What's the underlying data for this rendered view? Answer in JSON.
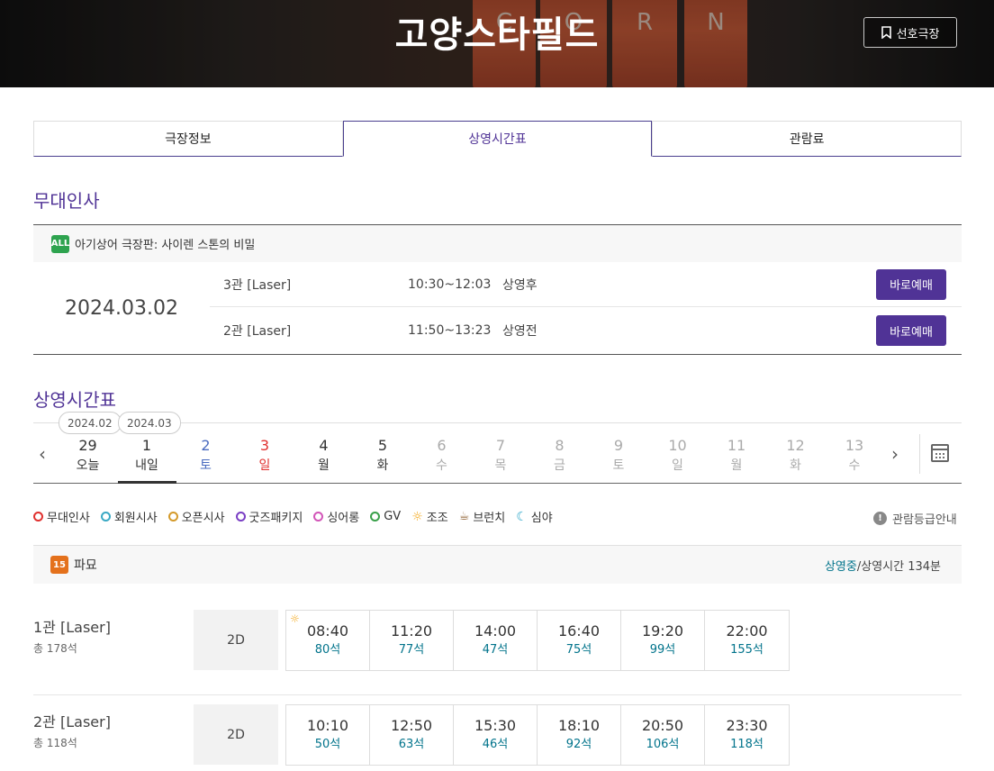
{
  "theater": {
    "name": "고양스타필드",
    "favorite_label": "선호극장"
  },
  "tabs": [
    {
      "label": "극장정보",
      "active": false
    },
    {
      "label": "상영시간표",
      "active": true
    },
    {
      "label": "관람료",
      "active": false
    }
  ],
  "stage_greeting": {
    "title": "무대인사",
    "movie": {
      "rating": "ALL",
      "title": "아기상어 극장판: 사이렌 스톤의 비밀"
    },
    "date": "2024.03.02",
    "rows": [
      {
        "hall": "3관 [Laser]",
        "time": "10:30~12:03",
        "status": "상영후",
        "button": "바로예매"
      },
      {
        "hall": "2관 [Laser]",
        "time": "11:50~13:23",
        "status": "상영전",
        "button": "바로예매"
      }
    ]
  },
  "schedule": {
    "title": "상영시간표",
    "months": [
      "2024.02",
      "2024.03"
    ],
    "days": [
      {
        "num": "29",
        "dow": "오늘",
        "color": "#333333",
        "selected": false
      },
      {
        "num": "1",
        "dow": "내일",
        "color": "#333333",
        "selected": true
      },
      {
        "num": "2",
        "dow": "토",
        "color": "#4a6bbf",
        "selected": false
      },
      {
        "num": "3",
        "dow": "일",
        "color": "#e0302e",
        "selected": false
      },
      {
        "num": "4",
        "dow": "월",
        "color": "#333333",
        "selected": false
      },
      {
        "num": "5",
        "dow": "화",
        "color": "#333333",
        "selected": false
      },
      {
        "num": "6",
        "dow": "수",
        "color": "#aaaaaa",
        "selected": false
      },
      {
        "num": "7",
        "dow": "목",
        "color": "#aaaaaa",
        "selected": false
      },
      {
        "num": "8",
        "dow": "금",
        "color": "#aaaaaa",
        "selected": false
      },
      {
        "num": "9",
        "dow": "토",
        "color": "#aaaaaa",
        "selected": false
      },
      {
        "num": "10",
        "dow": "일",
        "color": "#aaaaaa",
        "selected": false
      },
      {
        "num": "11",
        "dow": "월",
        "color": "#aaaaaa",
        "selected": false
      },
      {
        "num": "12",
        "dow": "화",
        "color": "#aaaaaa",
        "selected": false
      },
      {
        "num": "13",
        "dow": "수",
        "color": "#aaaaaa",
        "selected": false
      }
    ],
    "legend": [
      {
        "label": "무대인사",
        "icon": "stage-greeting-icon",
        "color": "#e0302e"
      },
      {
        "label": "회원시사",
        "icon": "member-preview-icon",
        "color": "#3aa9c4"
      },
      {
        "label": "오픈시사",
        "icon": "open-preview-icon",
        "color": "#d49a2a"
      },
      {
        "label": "굿즈패키지",
        "icon": "goods-package-icon",
        "color": "#7a3fc4"
      },
      {
        "label": "싱어롱",
        "icon": "sing-along-icon",
        "color": "#d255b8"
      },
      {
        "label": "GV",
        "icon": "gv-icon",
        "color": "#3aa04a"
      },
      {
        "label": "조조",
        "icon": "sun-icon",
        "color": "#f3a81c"
      },
      {
        "label": "브런치",
        "icon": "coffee-icon",
        "color": "#8a5a2a"
      },
      {
        "label": "심야",
        "icon": "moon-icon",
        "color": "#2aa6c9"
      }
    ],
    "rating_guide": "관람등급안내",
    "movie": {
      "rating": "15",
      "title": "파묘",
      "status": "상영중",
      "runtime": "/상영시간 134분"
    },
    "halls": [
      {
        "name": "1관 [Laser]",
        "seats": "총 178석",
        "type": "2D",
        "slots": [
          {
            "time": "08:40",
            "seats": "80석",
            "morning": true
          },
          {
            "time": "11:20",
            "seats": "77석",
            "morning": false
          },
          {
            "time": "14:00",
            "seats": "47석",
            "morning": false
          },
          {
            "time": "16:40",
            "seats": "75석",
            "morning": false
          },
          {
            "time": "19:20",
            "seats": "99석",
            "morning": false
          },
          {
            "time": "22:00",
            "seats": "155석",
            "morning": false
          }
        ]
      },
      {
        "name": "2관 [Laser]",
        "seats": "총 118석",
        "type": "2D",
        "slots": [
          {
            "time": "10:10",
            "seats": "50석",
            "morning": false
          },
          {
            "time": "12:50",
            "seats": "63석",
            "morning": false
          },
          {
            "time": "15:30",
            "seats": "46석",
            "morning": false
          },
          {
            "time": "18:10",
            "seats": "92석",
            "morning": false
          },
          {
            "time": "20:50",
            "seats": "106석",
            "morning": false
          },
          {
            "time": "23:30",
            "seats": "118석",
            "morning": false
          }
        ]
      }
    ]
  }
}
